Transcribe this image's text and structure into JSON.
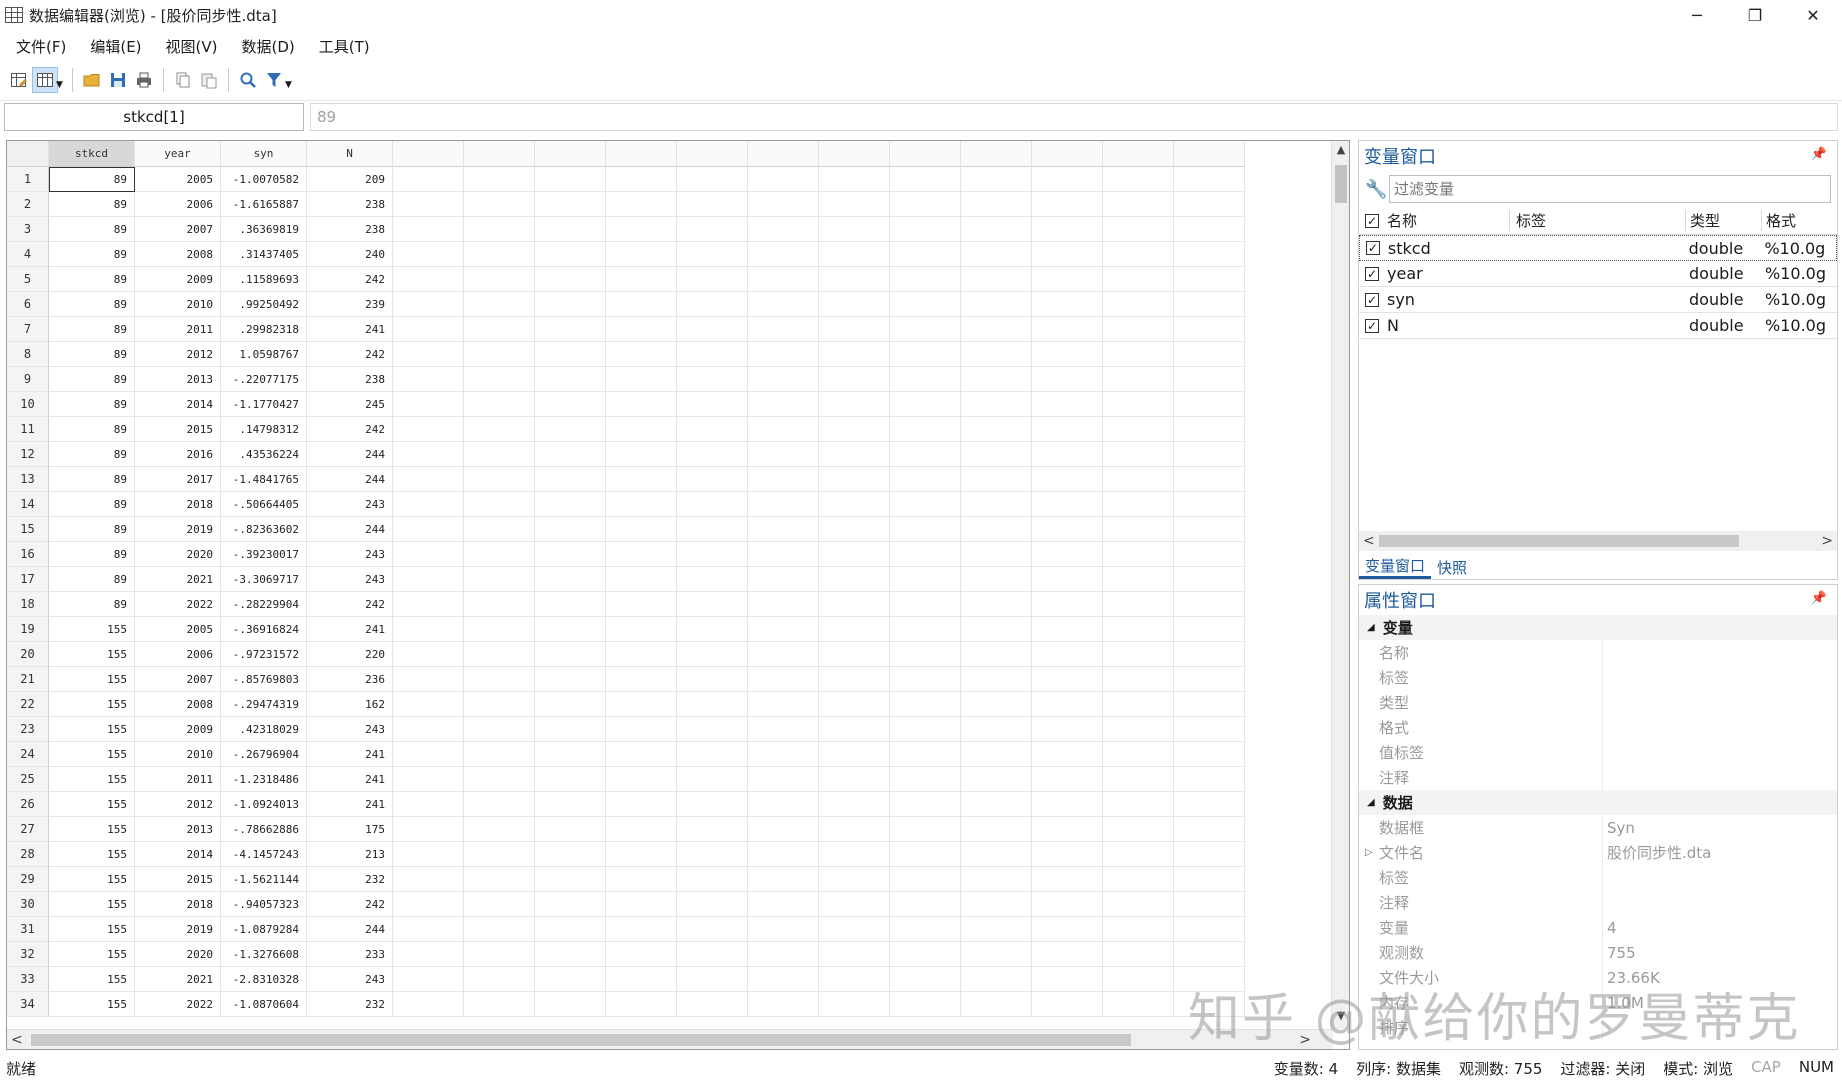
{
  "window": {
    "title": "数据编辑器(浏览) - [股价同步性.dta]",
    "min": "─",
    "restore": "❐",
    "close": "✕"
  },
  "menu": [
    "文件(F)",
    "编辑(E)",
    "视图(V)",
    "数据(D)",
    "工具(T)"
  ],
  "editbar": {
    "varname": "stkcd[1]",
    "value": "89"
  },
  "grid": {
    "columns": [
      "stkcd",
      "year",
      "syn",
      "N"
    ],
    "rows": [
      [
        "1",
        "89",
        "2005",
        "-1.0070582",
        "209"
      ],
      [
        "2",
        "89",
        "2006",
        "-1.6165887",
        "238"
      ],
      [
        "3",
        "89",
        "2007",
        ".36369819",
        "238"
      ],
      [
        "4",
        "89",
        "2008",
        ".31437405",
        "240"
      ],
      [
        "5",
        "89",
        "2009",
        ".11589693",
        "242"
      ],
      [
        "6",
        "89",
        "2010",
        ".99250492",
        "239"
      ],
      [
        "7",
        "89",
        "2011",
        ".29982318",
        "241"
      ],
      [
        "8",
        "89",
        "2012",
        "1.0598767",
        "242"
      ],
      [
        "9",
        "89",
        "2013",
        "-.22077175",
        "238"
      ],
      [
        "10",
        "89",
        "2014",
        "-1.1770427",
        "245"
      ],
      [
        "11",
        "89",
        "2015",
        ".14798312",
        "242"
      ],
      [
        "12",
        "89",
        "2016",
        ".43536224",
        "244"
      ],
      [
        "13",
        "89",
        "2017",
        "-1.4841765",
        "244"
      ],
      [
        "14",
        "89",
        "2018",
        "-.50664405",
        "243"
      ],
      [
        "15",
        "89",
        "2019",
        "-.82363602",
        "244"
      ],
      [
        "16",
        "89",
        "2020",
        "-.39230017",
        "243"
      ],
      [
        "17",
        "89",
        "2021",
        "-3.3069717",
        "243"
      ],
      [
        "18",
        "89",
        "2022",
        "-.28229904",
        "242"
      ],
      [
        "19",
        "155",
        "2005",
        "-.36916824",
        "241"
      ],
      [
        "20",
        "155",
        "2006",
        "-.97231572",
        "220"
      ],
      [
        "21",
        "155",
        "2007",
        "-.85769803",
        "236"
      ],
      [
        "22",
        "155",
        "2008",
        "-.29474319",
        "162"
      ],
      [
        "23",
        "155",
        "2009",
        ".42318029",
        "243"
      ],
      [
        "24",
        "155",
        "2010",
        "-.26796904",
        "241"
      ],
      [
        "25",
        "155",
        "2011",
        "-1.2318486",
        "241"
      ],
      [
        "26",
        "155",
        "2012",
        "-1.0924013",
        "241"
      ],
      [
        "27",
        "155",
        "2013",
        "-.78662886",
        "175"
      ],
      [
        "28",
        "155",
        "2014",
        "-4.1457243",
        "213"
      ],
      [
        "29",
        "155",
        "2015",
        "-1.5621144",
        "232"
      ],
      [
        "30",
        "155",
        "2018",
        "-.94057323",
        "242"
      ],
      [
        "31",
        "155",
        "2019",
        "-1.0879284",
        "244"
      ],
      [
        "32",
        "155",
        "2020",
        "-1.3276608",
        "233"
      ],
      [
        "33",
        "155",
        "2021",
        "-2.8310328",
        "243"
      ],
      [
        "34",
        "155",
        "2022",
        "-1.0870604",
        "232"
      ]
    ]
  },
  "var_panel": {
    "title": "变量窗口",
    "filter_placeholder": "过滤变量",
    "headers": {
      "name": "名称",
      "label": "标签",
      "type": "类型",
      "format": "格式"
    },
    "variables": [
      {
        "name": "stkcd",
        "label": "",
        "type": "double",
        "format": "%10.0g"
      },
      {
        "name": "year",
        "label": "",
        "type": "double",
        "format": "%10.0g"
      },
      {
        "name": "syn",
        "label": "",
        "type": "double",
        "format": "%10.0g"
      },
      {
        "name": "N",
        "label": "",
        "type": "double",
        "format": "%10.0g"
      }
    ],
    "tabs": [
      "变量窗口",
      "快照"
    ]
  },
  "prop_panel": {
    "title": "属性窗口",
    "sections": [
      {
        "name": "变量",
        "rows": [
          {
            "key": "名称",
            "value": ""
          },
          {
            "key": "标签",
            "value": ""
          },
          {
            "key": "类型",
            "value": ""
          },
          {
            "key": "格式",
            "value": ""
          },
          {
            "key": "值标签",
            "value": ""
          },
          {
            "key": "注释",
            "value": ""
          }
        ]
      },
      {
        "name": "数据",
        "rows": [
          {
            "key": "数据框",
            "value": "Syn"
          },
          {
            "key": "文件名",
            "value": "股价同步性.dta"
          },
          {
            "key": "标签",
            "value": ""
          },
          {
            "key": "注释",
            "value": ""
          },
          {
            "key": "变量",
            "value": "4"
          },
          {
            "key": "观测数",
            "value": "755"
          },
          {
            "key": "文件大小",
            "value": "23.66K"
          },
          {
            "key": "内存",
            "value": "1.0M"
          },
          {
            "key": "排序",
            "value": ""
          }
        ]
      }
    ]
  },
  "watermark": "知乎 @献给你的罗曼蒂克",
  "status": {
    "left": "就绪",
    "items": [
      "变量数: 4",
      "列序: 数据集",
      "观测数: 755",
      "过滤器: 关闭",
      "模式: 浏览"
    ],
    "cap": "CAP",
    "num": "NUM"
  }
}
